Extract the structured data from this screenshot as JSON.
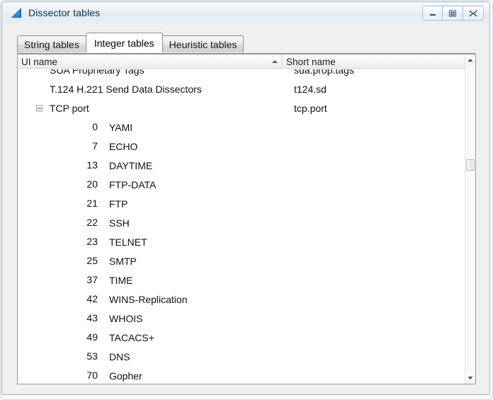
{
  "window": {
    "title": "Dissector tables",
    "icon": "wireshark-shark-fin-icon",
    "controls": {
      "minimize": "minimize-icon",
      "maximize": "maximize-icon",
      "close": "close-icon"
    }
  },
  "tabs": [
    {
      "label": "String tables",
      "active": false
    },
    {
      "label": "Integer tables",
      "active": true
    },
    {
      "label": "Heuristic tables",
      "active": false
    }
  ],
  "table": {
    "columns": [
      {
        "label": "UI name",
        "sort": "ascending"
      },
      {
        "label": "Short name",
        "indicator": "triangle-left-icon"
      }
    ],
    "rows": [
      {
        "ui_name": "SUA Proprietary Tags",
        "short_name": "sua.prop.tags",
        "type": "top",
        "clipped": true
      },
      {
        "ui_name": "T.124 H.221 Send Data Dissectors",
        "short_name": "t124.sd",
        "type": "top"
      },
      {
        "ui_name": "TCP port",
        "short_name": "tcp.port",
        "type": "parent",
        "expanded": true
      },
      {
        "ui_name": "0",
        "short_name": "YAMI",
        "type": "child"
      },
      {
        "ui_name": "7",
        "short_name": "ECHO",
        "type": "child"
      },
      {
        "ui_name": "13",
        "short_name": "DAYTIME",
        "type": "child"
      },
      {
        "ui_name": "20",
        "short_name": "FTP-DATA",
        "type": "child"
      },
      {
        "ui_name": "21",
        "short_name": "FTP",
        "type": "child"
      },
      {
        "ui_name": "22",
        "short_name": "SSH",
        "type": "child"
      },
      {
        "ui_name": "23",
        "short_name": "TELNET",
        "type": "child"
      },
      {
        "ui_name": "25",
        "short_name": "SMTP",
        "type": "child"
      },
      {
        "ui_name": "37",
        "short_name": "TIME",
        "type": "child"
      },
      {
        "ui_name": "42",
        "short_name": "WINS-Replication",
        "type": "child"
      },
      {
        "ui_name": "43",
        "short_name": "WHOIS",
        "type": "child"
      },
      {
        "ui_name": "49",
        "short_name": "TACACS+",
        "type": "child"
      },
      {
        "ui_name": "53",
        "short_name": "DNS",
        "type": "child"
      },
      {
        "ui_name": "70",
        "short_name": "Gopher",
        "type": "child",
        "clipped": true
      }
    ]
  },
  "scrollbar": {
    "up_arrow": "scroll-up-icon",
    "down_arrow": "scroll-down-icon",
    "thumb": "scroll-thumb"
  },
  "colors": {
    "accent": "#1a6fb5",
    "frame_border": "#9cb0c4",
    "titlebar_text": "#12304d",
    "list_border": "#9a9a9a"
  }
}
